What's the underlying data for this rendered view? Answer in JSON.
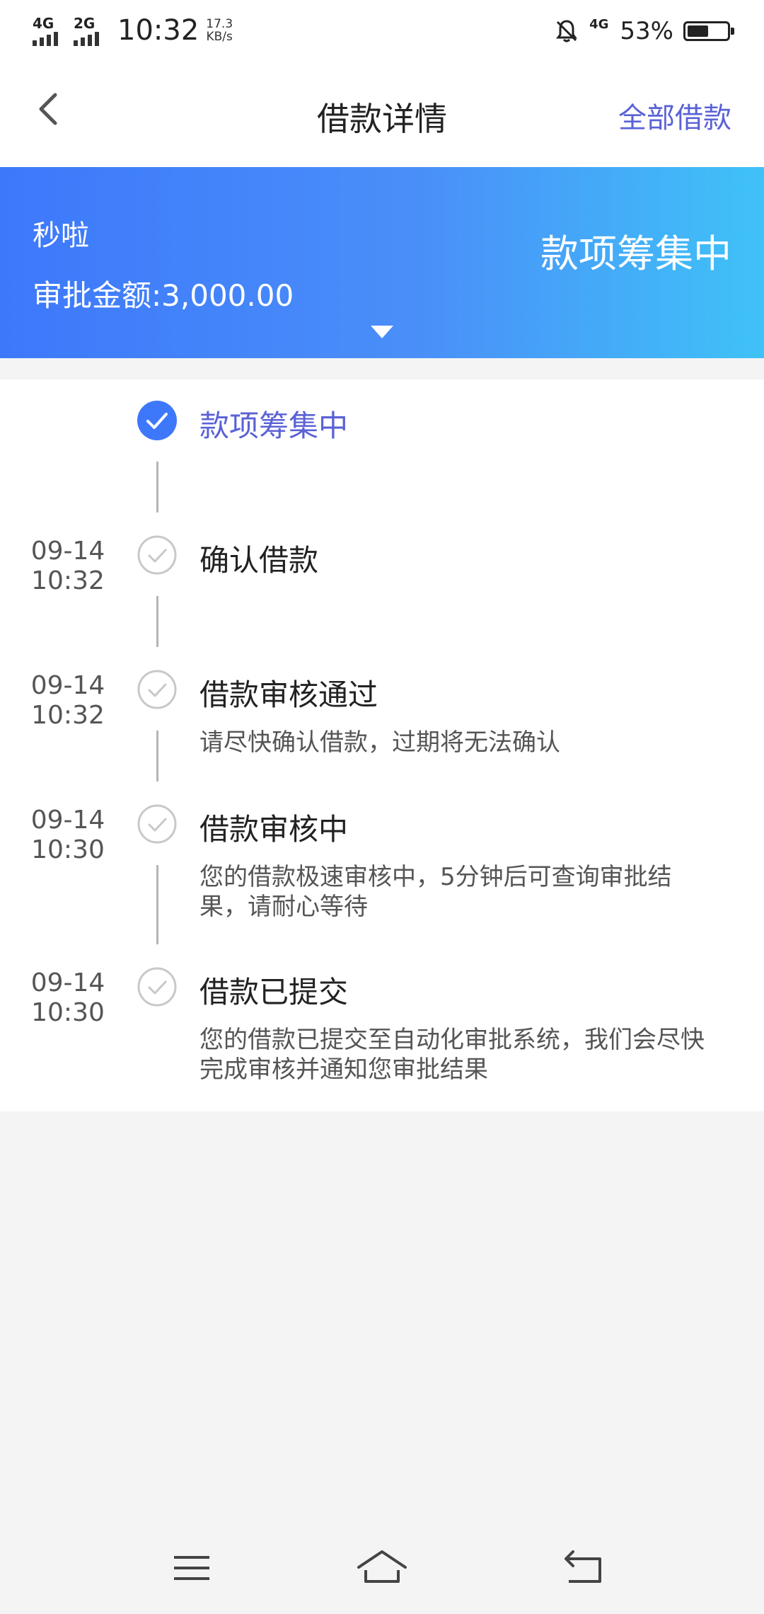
{
  "status_bar": {
    "sim1_network": "4G",
    "sim2_network": "2G",
    "time": "10:32",
    "speed_value": "17.3",
    "speed_unit": "KB/s",
    "extra_network": "4G",
    "battery_percent": "53%",
    "battery_level": 0.53
  },
  "header": {
    "back_icon": "chevron-left-icon",
    "title": "借款详情",
    "right_link": "全部借款"
  },
  "banner": {
    "product_name": "秒啦",
    "amount_text": "审批金额:3,000.00",
    "status": "款项筹集中",
    "expand_icon": "triangle-down-icon",
    "colors": {
      "start": "#3d78fb",
      "end": "#3fc2f7"
    }
  },
  "timeline": {
    "items": [
      {
        "date": "",
        "time": "",
        "title": "款项筹集中",
        "desc": "",
        "active": true
      },
      {
        "date": "09-14",
        "time": "10:32",
        "title": "确认借款",
        "desc": "",
        "active": false
      },
      {
        "date": "09-14",
        "time": "10:32",
        "title": "借款审核通过",
        "desc": "请尽快确认借款，过期将无法确认",
        "active": false
      },
      {
        "date": "09-14",
        "time": "10:30",
        "title": "借款审核中",
        "desc": "您的借款极速审核中，5分钟后可查询审批结果，请耐心等待",
        "active": false
      },
      {
        "date": "09-14",
        "time": "10:30",
        "title": "借款已提交",
        "desc": "您的借款已提交至自动化审批系统，我们会尽快完成审核并通知您审批结果",
        "active": false
      }
    ],
    "colors": {
      "active": "#3d78fb",
      "inactive": "#c8c8c8",
      "active_text": "#5a62d6"
    }
  },
  "bottom_nav": {
    "menu_icon": "menu-icon",
    "home_icon": "home-icon",
    "back_icon": "back-arrow-icon"
  }
}
